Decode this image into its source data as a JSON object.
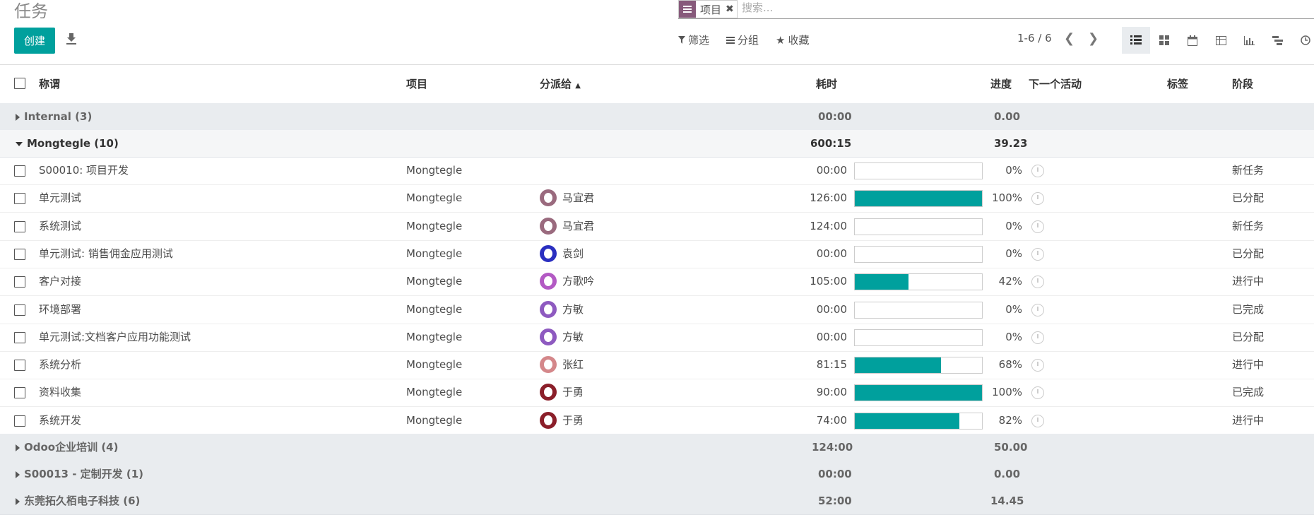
{
  "title": "任务",
  "create_label": "创建",
  "search": {
    "facet": "项目",
    "placeholder": "搜索..."
  },
  "filters": {
    "filter": "筛选",
    "group": "分组",
    "favorite": "收藏"
  },
  "pager": "1-6 / 6",
  "columns": {
    "name": "称谓",
    "project": "项目",
    "assignee": "分派给",
    "time": "耗时",
    "progress": "进度",
    "activity": "下一个活动",
    "tags": "标签",
    "stage": "阶段"
  },
  "groups": [
    {
      "label": "Internal (3)",
      "time": "00:00",
      "progress": "0.00"
    },
    {
      "label": "Mongtegle (10)",
      "time": "600:15",
      "progress": "39.23"
    },
    {
      "label": "Odoo企业培训 (4)",
      "time": "124:00",
      "progress": "50.00"
    },
    {
      "label": "S00013 - 定制开发 (1)",
      "time": "00:00",
      "progress": "0.00"
    },
    {
      "label": "东莞拓久栢电子科技 (6)",
      "time": "52:00",
      "progress": "14.45"
    }
  ],
  "rows": [
    {
      "name": "S00010: 项目开发",
      "project": "Mongtegle",
      "assignee": "",
      "avatar_color": "",
      "time": "00:00",
      "pct": 0,
      "pct_label": "0%",
      "stage": "新任务"
    },
    {
      "name": "单元测试",
      "project": "Mongtegle",
      "assignee": "马宜君",
      "avatar_color": "#9a6a7e",
      "time": "126:00",
      "pct": 100,
      "pct_label": "100%",
      "stage": "已分配"
    },
    {
      "name": "系统测试",
      "project": "Mongtegle",
      "assignee": "马宜君",
      "avatar_color": "#9a6a7e",
      "time": "124:00",
      "pct": 0,
      "pct_label": "0%",
      "stage": "新任务"
    },
    {
      "name": "单元测试: 销售佣金应用测试",
      "project": "Mongtegle",
      "assignee": "袁剑",
      "avatar_color": "#2a2fc0",
      "time": "00:00",
      "pct": 0,
      "pct_label": "0%",
      "stage": "已分配"
    },
    {
      "name": "客户对接",
      "project": "Mongtegle",
      "assignee": "方歌吟",
      "avatar_color": "#b35ac4",
      "time": "105:00",
      "pct": 42,
      "pct_label": "42%",
      "stage": "进行中"
    },
    {
      "name": "环境部署",
      "project": "Mongtegle",
      "assignee": "方敏",
      "avatar_color": "#8e5ac0",
      "time": "00:00",
      "pct": 0,
      "pct_label": "0%",
      "stage": "已完成"
    },
    {
      "name": "单元测试:文档客户应用功能测试",
      "project": "Mongtegle",
      "assignee": "方敏",
      "avatar_color": "#8e5ac0",
      "time": "00:00",
      "pct": 0,
      "pct_label": "0%",
      "stage": "已分配"
    },
    {
      "name": "系统分析",
      "project": "Mongtegle",
      "assignee": "张红",
      "avatar_color": "#d4878a",
      "time": "81:15",
      "pct": 68,
      "pct_label": "68%",
      "stage": "进行中"
    },
    {
      "name": "资料收集",
      "project": "Mongtegle",
      "assignee": "于勇",
      "avatar_color": "#8b1f2a",
      "time": "90:00",
      "pct": 100,
      "pct_label": "100%",
      "stage": "已完成"
    },
    {
      "name": "系统开发",
      "project": "Mongtegle",
      "assignee": "于勇",
      "avatar_color": "#8b1f2a",
      "time": "74:00",
      "pct": 82,
      "pct_label": "82%",
      "stage": "进行中"
    }
  ],
  "colors": {
    "primary": "#00a09d",
    "facet": "#875a7b"
  }
}
